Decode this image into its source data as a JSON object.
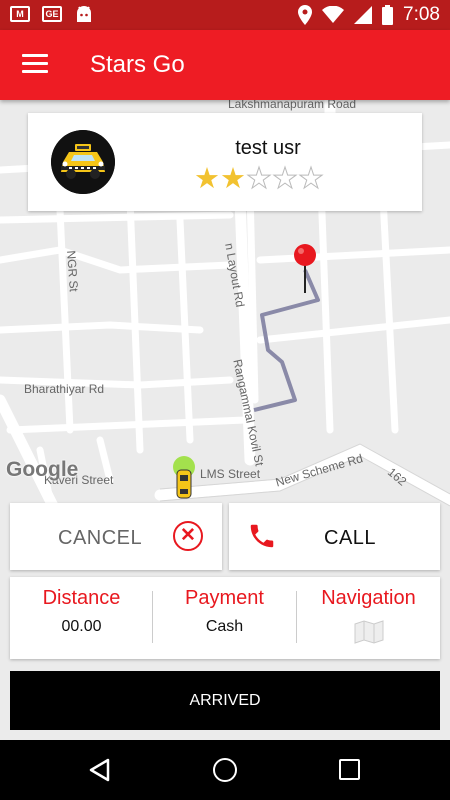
{
  "status_bar": {
    "time": "7:08",
    "notif_gmail": "M",
    "notif_ge": "GE"
  },
  "app_bar": {
    "title": "Stars Go"
  },
  "map": {
    "labels": {
      "lakshmanapuram": "Lakshmanapuram Road",
      "layout_rd": "n Layout Rd",
      "ngr": "NGR St",
      "bharathiyar": "Bharathiyar Rd",
      "rangammal": "Rangammal Kovil St",
      "kaveri": "Kaveri Street",
      "lms": "LMS Street",
      "new_scheme": "New Scheme Rd",
      "road_162": "162"
    },
    "attribution": "Google"
  },
  "driver": {
    "name": "test usr",
    "rating": 2,
    "rating_max": 5
  },
  "actions": {
    "cancel_label": "CANCEL",
    "call_label": "CALL"
  },
  "trip_info": {
    "distance_label": "Distance",
    "distance_value": "00.00",
    "payment_label": "Payment",
    "payment_value": "Cash",
    "navigation_label": "Navigation"
  },
  "arrived_label": "ARRIVED",
  "colors": {
    "primary": "#ee1c24",
    "status_bar": "#b71c1c",
    "accent_red": "#e8181f",
    "star": "#f2c230",
    "route": "#8a8aa8"
  },
  "icons": [
    "menu-icon",
    "taxi-icon",
    "cancel-circle-icon",
    "phone-icon",
    "folded-map-icon",
    "map-pin-icon",
    "back-icon",
    "home-icon",
    "recents-icon"
  ]
}
